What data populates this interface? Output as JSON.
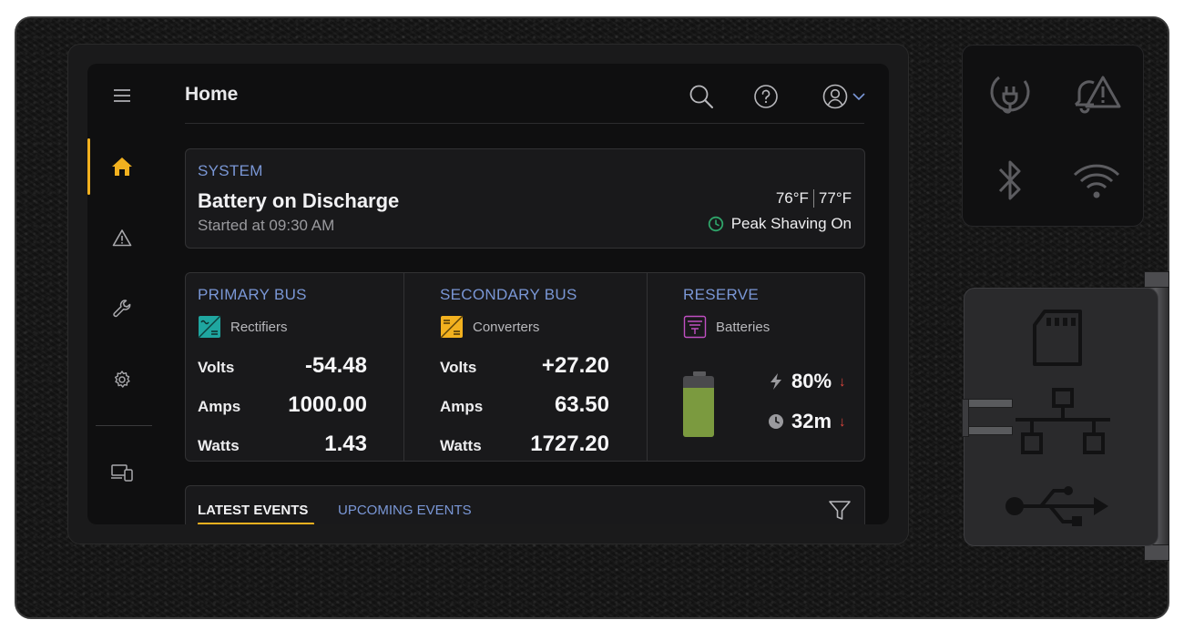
{
  "header": {
    "title": "Home"
  },
  "system": {
    "section_label": "SYSTEM",
    "status": "Battery on Discharge",
    "started": "Started at 09:30 AM",
    "temp_1": "76°F",
    "temp_2": "77°F",
    "mode": "Peak Shaving On"
  },
  "primary_bus": {
    "label": "PRIMARY BUS",
    "source": "Rectifiers",
    "volts_label": "Volts",
    "volts": "-54.48",
    "amps_label": "Amps",
    "amps": "1000.00",
    "watts_label": "Watts",
    "watts": "1.43"
  },
  "secondary_bus": {
    "label": "SECONDARY BUS",
    "source": "Converters",
    "volts_label": "Volts",
    "volts": "+27.20",
    "amps_label": "Amps",
    "amps": "63.50",
    "watts_label": "Watts",
    "watts": "1727.20"
  },
  "reserve": {
    "label": "RESERVE",
    "source": "Batteries",
    "charge": "80%",
    "charge_level": 0.8,
    "runtime": "32m"
  },
  "events": {
    "tab_latest": "LATEST EVENTS",
    "tab_upcoming": "UPCOMING EVENTS"
  },
  "colors": {
    "accent": "#f2b11f",
    "label_blue": "#7a97d6",
    "battery_green": "#7b9a3f",
    "rectifier_teal": "#1fa6a0",
    "reserve_magenta": "#c04fc2",
    "alert_red": "#e2463d",
    "peak_green": "#2fa56a"
  },
  "icons": {
    "menu": "hamburger-icon",
    "home": "home-icon",
    "alerts": "warning-icon",
    "tools": "wrench-icon",
    "settings": "gear-icon",
    "devices": "devices-icon",
    "search": "search-icon",
    "help": "help-icon",
    "user": "user-icon",
    "power": "power-plug-icon",
    "alarm": "alarm-bell-icon",
    "bluetooth": "bluetooth-icon",
    "wifi": "wifi-icon",
    "sd": "sd-card-icon",
    "network": "network-icon",
    "usb": "usb-icon"
  }
}
